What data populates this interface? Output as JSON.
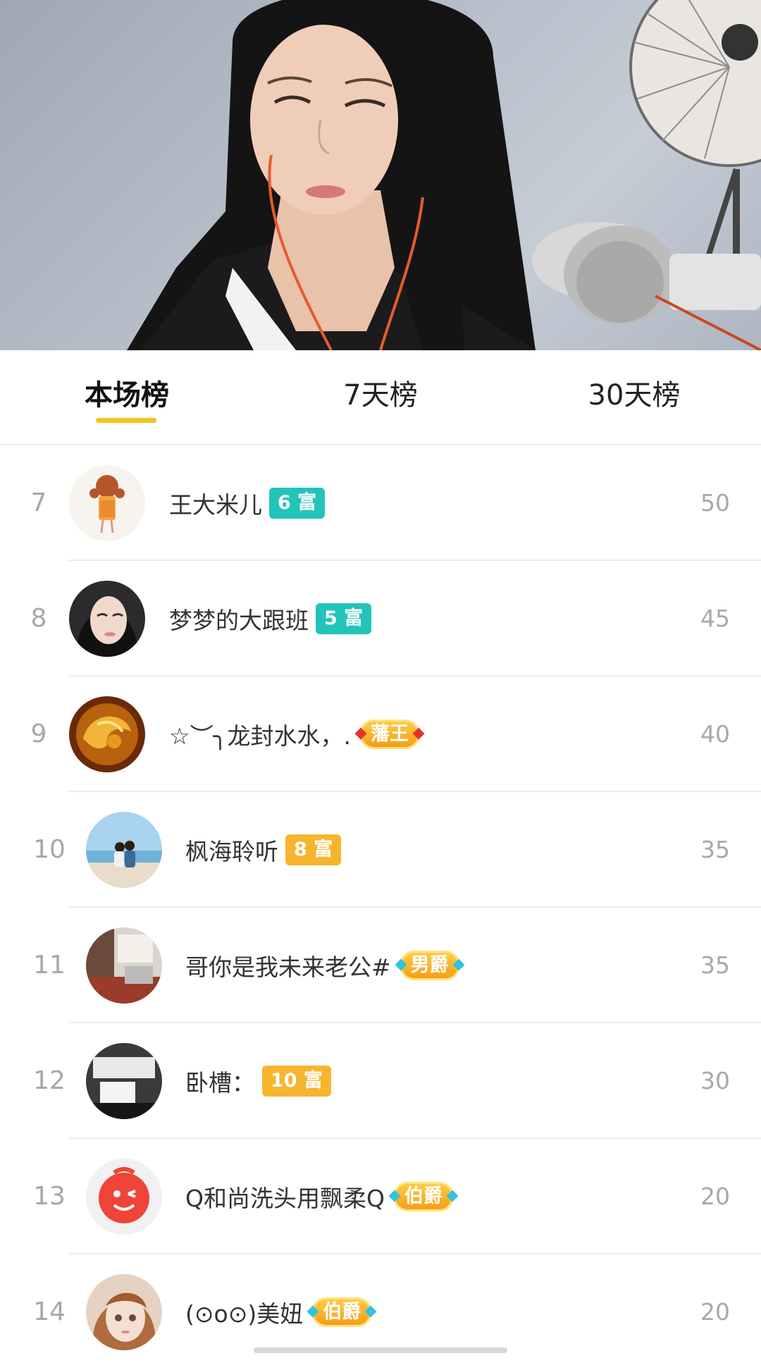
{
  "tabs": [
    {
      "label": "本场榜",
      "active": true
    },
    {
      "label": "7天榜",
      "active": false
    },
    {
      "label": "30天榜",
      "active": false
    }
  ],
  "colors": {
    "accent": "#f5c518",
    "teal_badge": "#22c4b9",
    "orange_badge": "#f7b52e"
  },
  "ranking": [
    {
      "rank": "7",
      "name": "王大米儿",
      "badge": "6 富",
      "badge_type": "teal",
      "score": "50",
      "avatar_icon": "cartoon-girl-avatar"
    },
    {
      "rank": "8",
      "name": "梦梦的大跟班",
      "badge": "5 富",
      "badge_type": "teal",
      "score": "45",
      "avatar_icon": "selfie-avatar"
    },
    {
      "rank": "9",
      "name": "☆︶╮龙封水水，.",
      "badge": "藩王",
      "badge_type": "noble-red",
      "score": "40",
      "avatar_icon": "golden-dragon-avatar"
    },
    {
      "rank": "10",
      "name": "枫海聆听",
      "badge": "8 富",
      "badge_type": "orange",
      "score": "35",
      "avatar_icon": "beach-couple-avatar"
    },
    {
      "rank": "11",
      "name": "哥你是我未来老公#",
      "badge": "男爵",
      "badge_type": "noble-cyan",
      "score": "35",
      "avatar_icon": "room-avatar"
    },
    {
      "rank": "12",
      "name": "卧槽：",
      "badge": "10 富",
      "badge_type": "orange",
      "score": "30",
      "avatar_icon": "office-avatar"
    },
    {
      "rank": "13",
      "name": "Q和尚洗头用飘柔Q",
      "badge": "伯爵",
      "badge_type": "noble-cyan",
      "score": "20",
      "avatar_icon": "red-wink-face-avatar"
    },
    {
      "rank": "14",
      "name": "(⊙o⊙)美妞",
      "badge": "伯爵",
      "badge_type": "noble-cyan",
      "score": "20",
      "avatar_icon": "doll-avatar"
    }
  ]
}
